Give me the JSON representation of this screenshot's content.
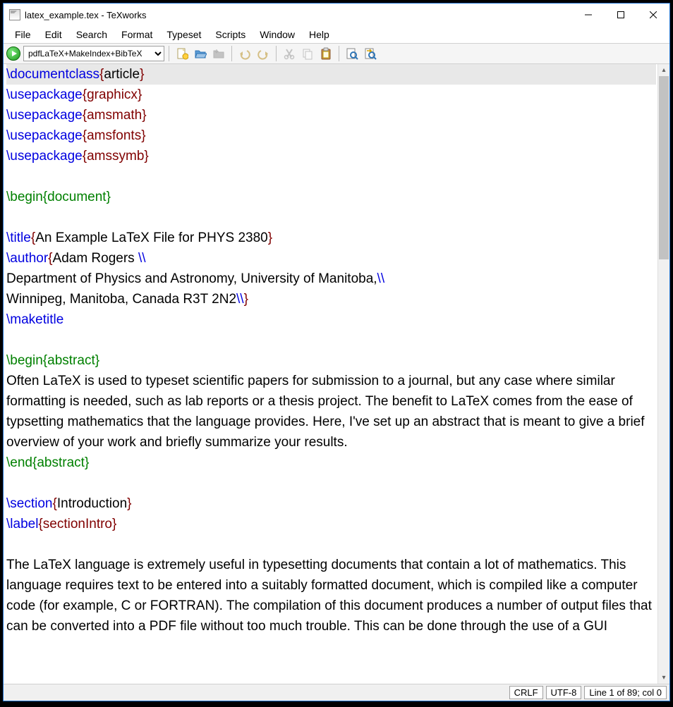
{
  "window": {
    "title": "latex_example.tex - TeXworks"
  },
  "menu": {
    "file": "File",
    "edit": "Edit",
    "search": "Search",
    "format": "Format",
    "typeset": "Typeset",
    "scripts": "Scripts",
    "window": "Window",
    "help": "Help"
  },
  "toolbar": {
    "engine": "pdfLaTeX+MakeIndex+BibTeX"
  },
  "editor": {
    "l1_cmd": "\\documentclass",
    "l1_arg": "article",
    "l2_cmd": "\\usepackage",
    "l2_arg": "graphicx",
    "l3_cmd": "\\usepackage",
    "l3_arg": "amsmath",
    "l4_cmd": "\\usepackage",
    "l4_arg": "amsfonts",
    "l5_cmd": "\\usepackage",
    "l5_arg": "amssymb",
    "l7_cmd": "\\begin",
    "l7_arg": "document",
    "l9_cmd": "\\title",
    "l9_txt": "An Example LaTeX File for PHYS 2380",
    "l10_cmd": "\\author",
    "l10_txt": "Adam Rogers ",
    "l10_bs": "\\\\",
    "l11_txt": "Department of Physics and Astronomy, University of Manitoba,",
    "l11_bs": "\\\\",
    "l12_txt": "Winnipeg, Manitoba, Canada R3T 2N2",
    "l12_bs": "\\\\",
    "l13_cmd": "\\maketitle",
    "l15_cmd": "\\begin",
    "l15_arg": "abstract",
    "abstract_body": "Often LaTeX is used to typeset scientific papers for submission to a journal, but any case where similar formatting is needed, such as lab reports or a thesis project. The benefit to LaTeX comes from the ease of typsetting mathematics that the language provides. Here, I've set up an abstract that is meant to give a brief overview of your work and briefly summarize your results.",
    "l17_cmd": "\\end",
    "l17_arg": "abstract",
    "l19_cmd": "\\section",
    "l19_arg": "Introduction",
    "l20_cmd": "\\label",
    "l20_arg": "sectionIntro",
    "intro_body": "The LaTeX language is extremely useful in typesetting documents that contain a lot of mathematics. This language requires text to be entered into a suitably formatted document, which is compiled like a computer code (for example, C or FORTRAN). The compilation of this document produces a number of output files that can be converted into a PDF file without too much trouble. This can be done through the use of a GUI"
  },
  "status": {
    "crlf": "CRLF",
    "encoding": "UTF-8",
    "position": "Line 1 of 89; col 0"
  }
}
